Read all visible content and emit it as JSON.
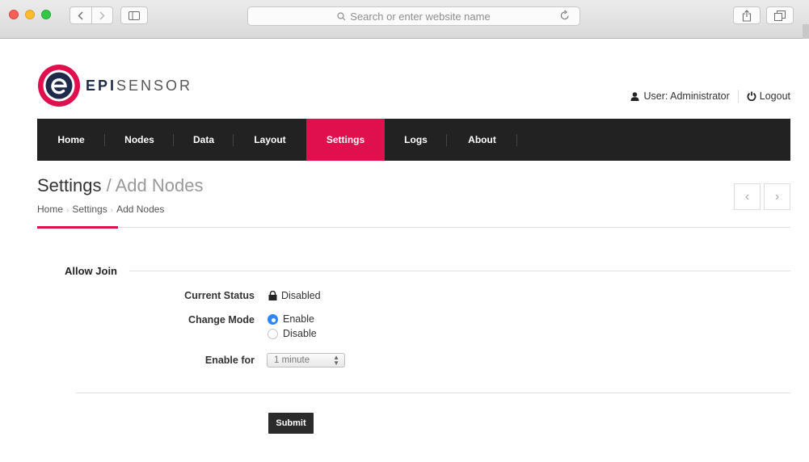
{
  "browser": {
    "address_placeholder": "Search or enter website name"
  },
  "brand": {
    "logo_letter": "e",
    "name_bold": "EPI",
    "name_light": "SENSOR",
    "accent": "#e0104e",
    "navy": "#1f2a4b"
  },
  "userbar": {
    "user_label": "User: Administrator",
    "logout_label": "Logout"
  },
  "nav": {
    "items": [
      {
        "label": "Home"
      },
      {
        "label": "Nodes"
      },
      {
        "label": "Data"
      },
      {
        "label": "Layout"
      },
      {
        "label": "Settings",
        "active": true
      },
      {
        "label": "Logs"
      },
      {
        "label": "About"
      }
    ]
  },
  "header": {
    "title_main": "Settings",
    "title_sub": " / Add Nodes",
    "breadcrumb": [
      "Home",
      "Settings",
      "Add Nodes"
    ]
  },
  "form": {
    "section_title": "Allow Join",
    "current_status_label": "Current Status",
    "current_status_value": "Disabled",
    "change_mode_label": "Change Mode",
    "mode_options": [
      {
        "label": "Enable",
        "selected": true
      },
      {
        "label": "Disable",
        "selected": false
      }
    ],
    "enable_for_label": "Enable for",
    "enable_for_value": "1 minute",
    "submit_label": "Submit"
  }
}
